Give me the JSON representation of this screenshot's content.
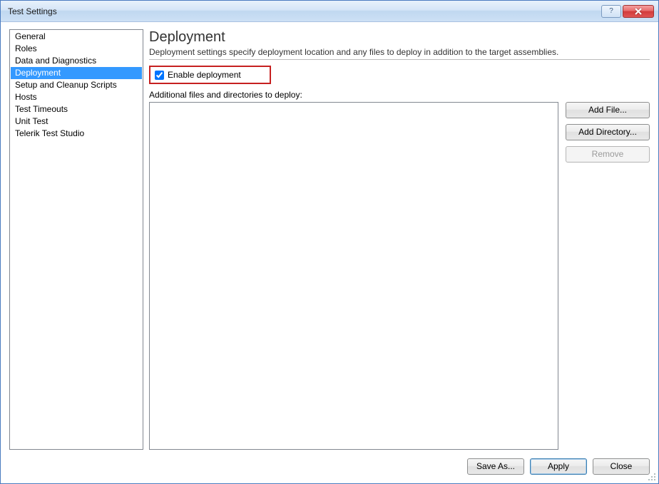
{
  "window": {
    "title": "Test Settings"
  },
  "sidebar": {
    "items": [
      {
        "label": "General"
      },
      {
        "label": "Roles"
      },
      {
        "label": "Data and Diagnostics"
      },
      {
        "label": "Deployment",
        "selected": true
      },
      {
        "label": "Setup and Cleanup Scripts"
      },
      {
        "label": "Hosts"
      },
      {
        "label": "Test Timeouts"
      },
      {
        "label": "Unit Test"
      },
      {
        "label": "Telerik Test Studio"
      }
    ]
  },
  "content": {
    "heading": "Deployment",
    "description": "Deployment settings specify deployment location and any files to deploy in addition to the target assemblies.",
    "enable_checkbox_label": "Enable deployment",
    "enable_checkbox_checked": true,
    "additional_label": "Additional files and directories to deploy:",
    "buttons": {
      "add_file": "Add File...",
      "add_dir": "Add Directory...",
      "remove": "Remove"
    }
  },
  "footer": {
    "save_as": "Save As...",
    "apply": "Apply",
    "close": "Close"
  },
  "titlebar_buttons": {
    "help_glyph": "?",
    "close_glyph": "✕"
  }
}
